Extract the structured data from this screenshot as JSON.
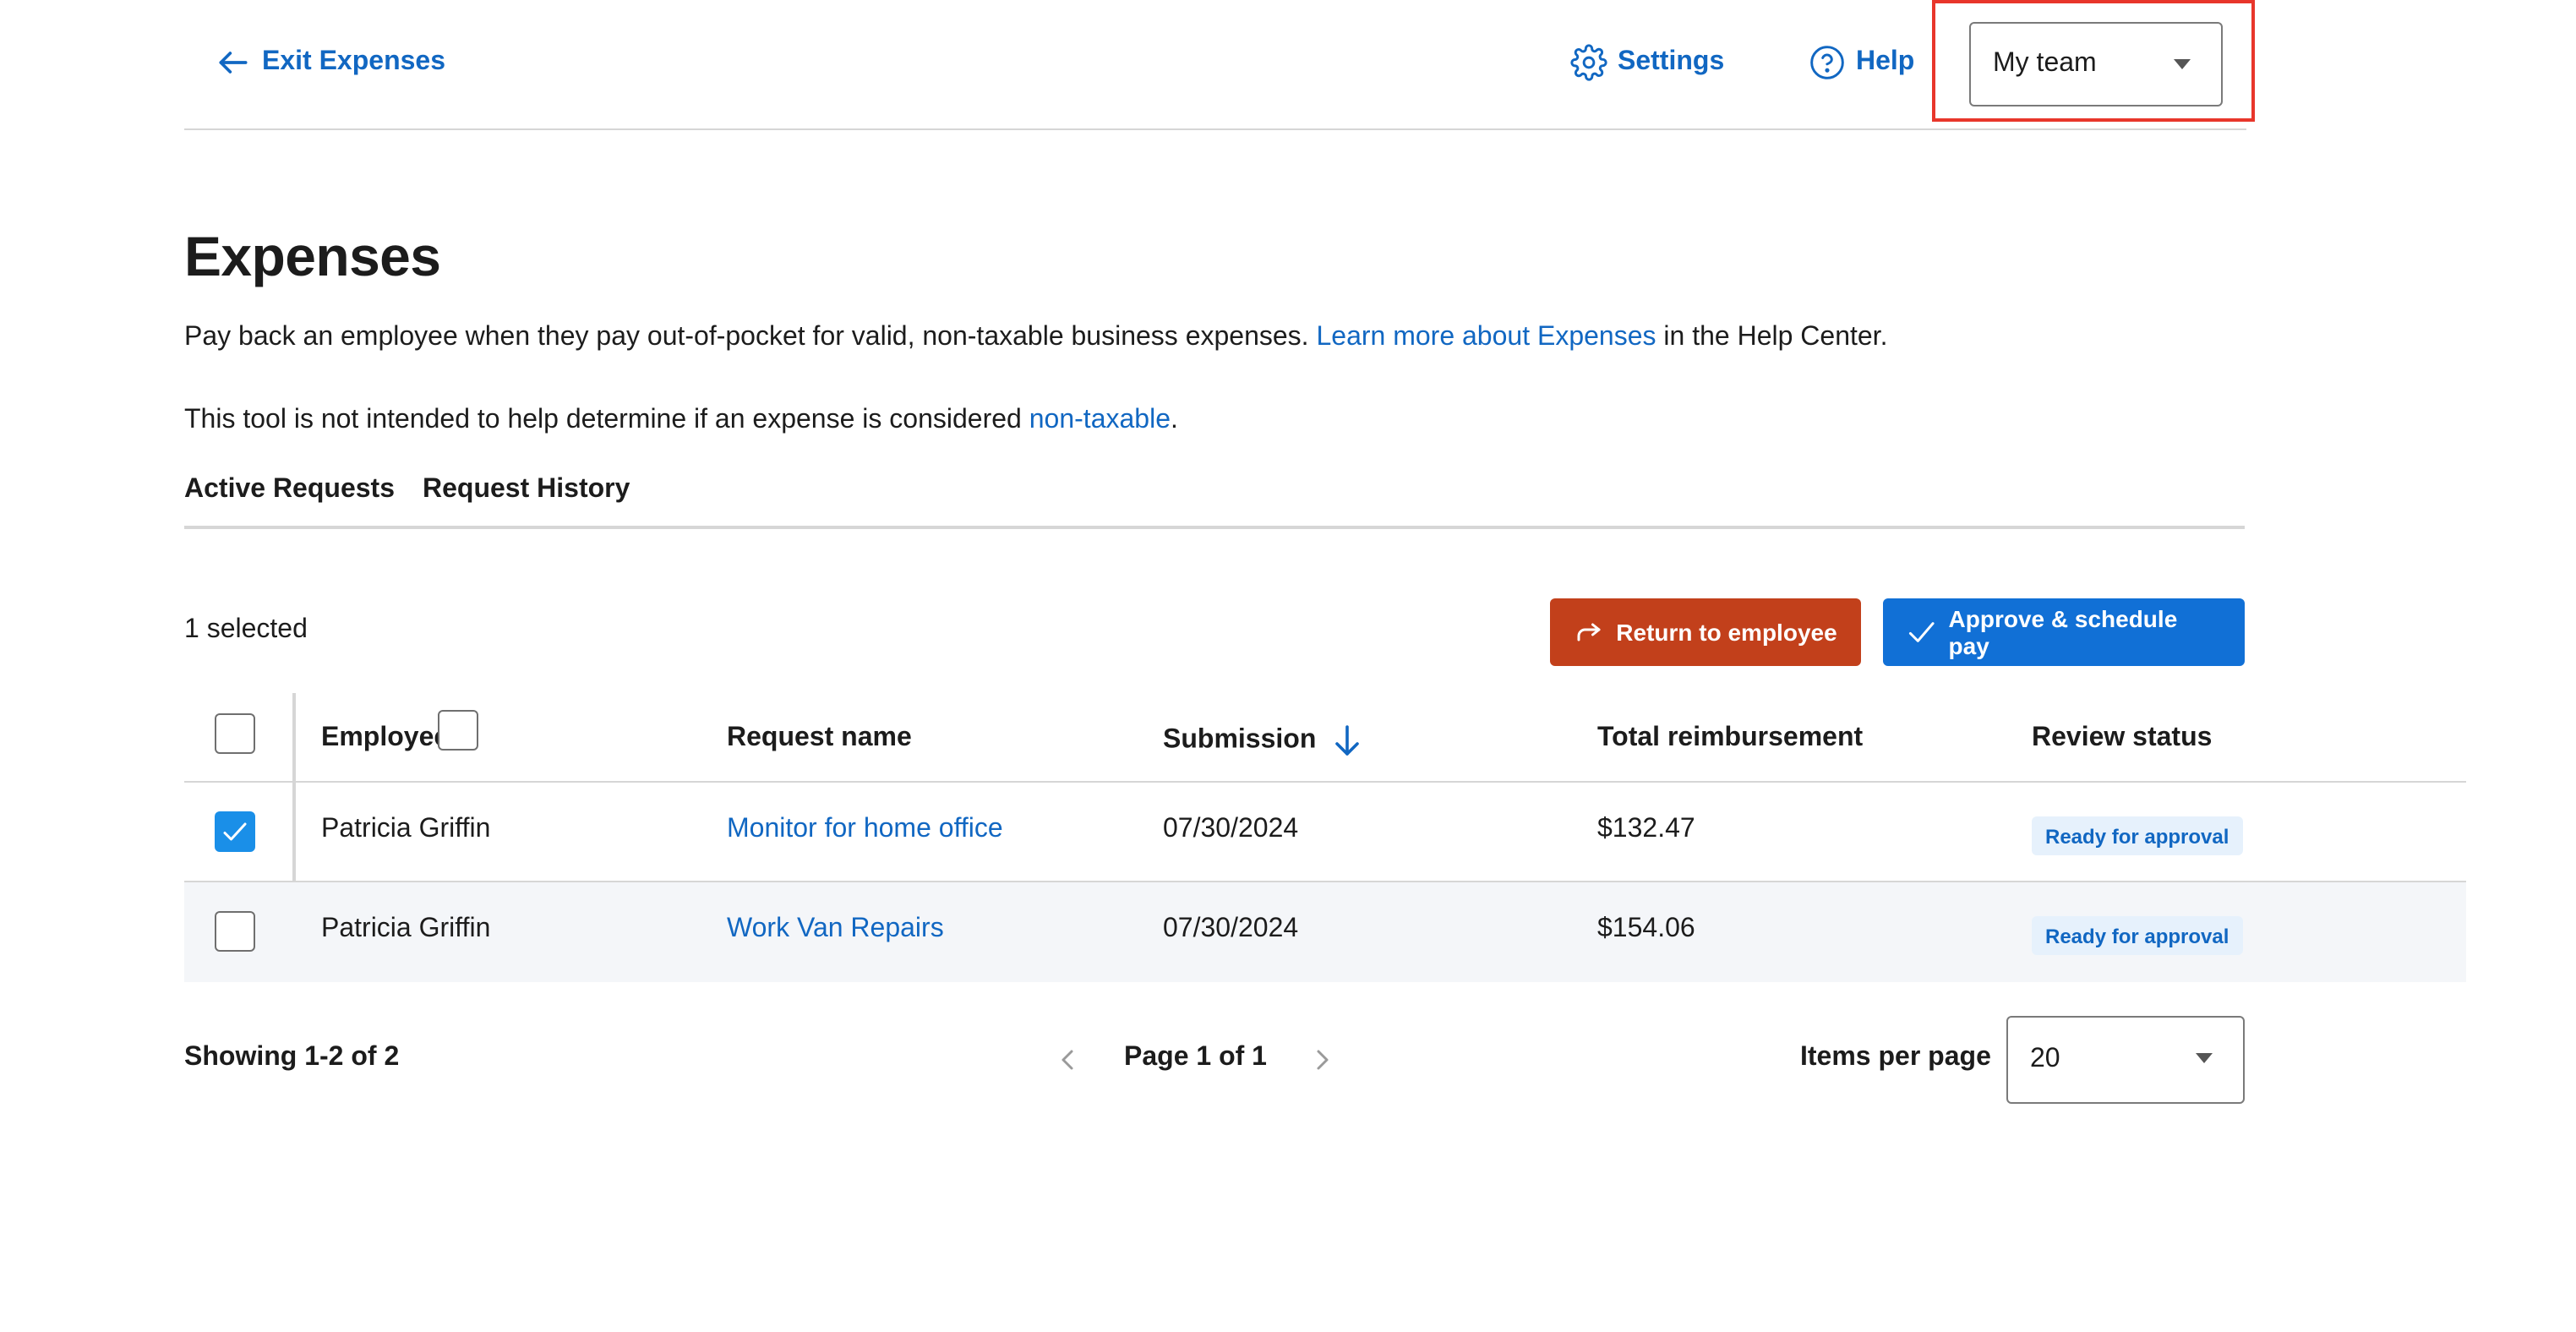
{
  "header": {
    "exit_label": "Exit Expenses",
    "settings_label": "Settings",
    "help_label": "Help",
    "team_select_value": "My team"
  },
  "page": {
    "title": "Expenses",
    "description_prefix": "Pay back an employee when they pay out-of-pocket for valid, non-taxable business expenses.",
    "description_link": "Learn more about Expenses",
    "description_suffix": "in the Help Center.",
    "note_prefix": "This tool is not intended to help determine if an expense is considered",
    "note_link": "non-taxable",
    "note_suffix": "."
  },
  "tabs": [
    {
      "label": "Active Requests"
    },
    {
      "label": "Request History"
    }
  ],
  "actions": {
    "selected_text": "1 selected",
    "return_label": "Return to employee",
    "approve_label": "Approve & schedule pay"
  },
  "table": {
    "columns": {
      "employee": "Employee",
      "request_name": "Request name",
      "submission": "Submission",
      "total": "Total reimbursement",
      "status": "Review status"
    },
    "rows": [
      {
        "selected": true,
        "employee": "Patricia Griffin",
        "request_name": "Monitor for home office",
        "submission": "07/30/2024",
        "total": "$132.47",
        "status": "Ready for approval"
      },
      {
        "selected": false,
        "employee": "Patricia Griffin",
        "request_name": "Work Van Repairs",
        "submission": "07/30/2024",
        "total": "$154.06",
        "status": "Ready for approval"
      }
    ]
  },
  "pagination": {
    "showing_text": "Showing 1-2 of 2",
    "page_text": "Page 1 of 1",
    "items_per_page_label": "Items per page",
    "items_per_page_value": "20"
  },
  "colors": {
    "link": "#1167c2",
    "return_button": "#c2401b",
    "approve_button": "#1170d6",
    "highlight": "#e8362b"
  }
}
